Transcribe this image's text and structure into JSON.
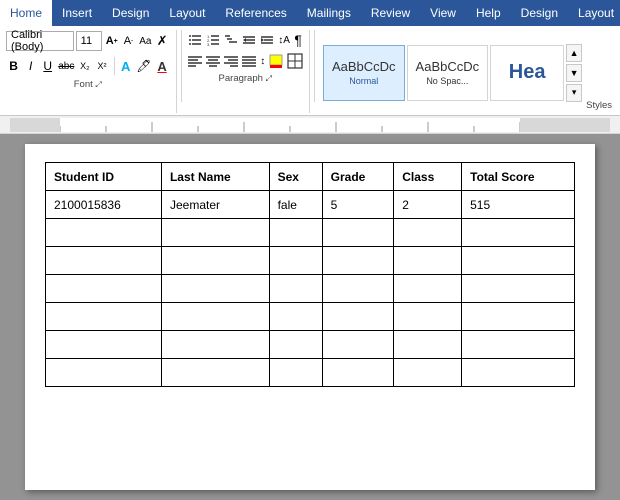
{
  "menubar": {
    "tabs": [
      "Home",
      "Insert",
      "Design",
      "Layout",
      "References",
      "Mailings",
      "Review",
      "View",
      "Help",
      "Design",
      "Layout"
    ],
    "active": "Home",
    "icon": "⚡"
  },
  "ribbon": {
    "font_group": {
      "label": "Font",
      "font_name": "Calibri (Body)",
      "font_size": "11",
      "grow_icon": "A↑",
      "shrink_icon": "A↓",
      "change_case_icon": "Aa",
      "clear_icon": "✗",
      "bold": "B",
      "italic": "I",
      "underline": "U",
      "strikethrough": "abc",
      "subscript": "X₂",
      "superscript": "X²",
      "text_effects": "A",
      "text_color": "A",
      "highlight": "🖊"
    },
    "paragraph_group": {
      "label": "Paragraph",
      "bullets": "≡",
      "numbering": "≡",
      "multi_level": "≡",
      "decrease_indent": "←≡",
      "increase_indent": "→≡",
      "sort": "↕A",
      "show_marks": "¶",
      "align_left": "≡",
      "align_center": "≡",
      "align_right": "≡",
      "justify": "≡",
      "line_spacing": "↕",
      "shading": "■",
      "borders": "⊞"
    },
    "styles_group": {
      "label": "Styles",
      "styles": [
        {
          "id": "normal",
          "preview": "AaBbCcDc",
          "label": "Normal",
          "selected": true
        },
        {
          "id": "no-spacing",
          "preview": "AaBbCcDc",
          "label": "No Spac...",
          "selected": false
        },
        {
          "id": "heading1",
          "preview": "Hea",
          "label": "",
          "selected": false
        }
      ]
    }
  },
  "ruler": {
    "visible": true
  },
  "table": {
    "headers": [
      "Student ID",
      "Last Name",
      "Sex",
      "Grade",
      "Class",
      "Total Score"
    ],
    "rows": [
      [
        "2100015836",
        "Jeemater",
        "fale",
        "5",
        "2",
        "515"
      ],
      [
        "",
        "",
        "",
        "",
        "",
        ""
      ],
      [
        "",
        "",
        "",
        "",
        "",
        ""
      ],
      [
        "",
        "",
        "",
        "",
        "",
        ""
      ],
      [
        "",
        "",
        "",
        "",
        "",
        ""
      ],
      [
        "",
        "",
        "",
        "",
        "",
        ""
      ],
      [
        "",
        "",
        "",
        "",
        "",
        ""
      ]
    ]
  },
  "colors": {
    "ribbon_blue": "#2b579a",
    "active_tab_bg": "#ffffff",
    "normal_style_selected": "#ddeeff"
  }
}
